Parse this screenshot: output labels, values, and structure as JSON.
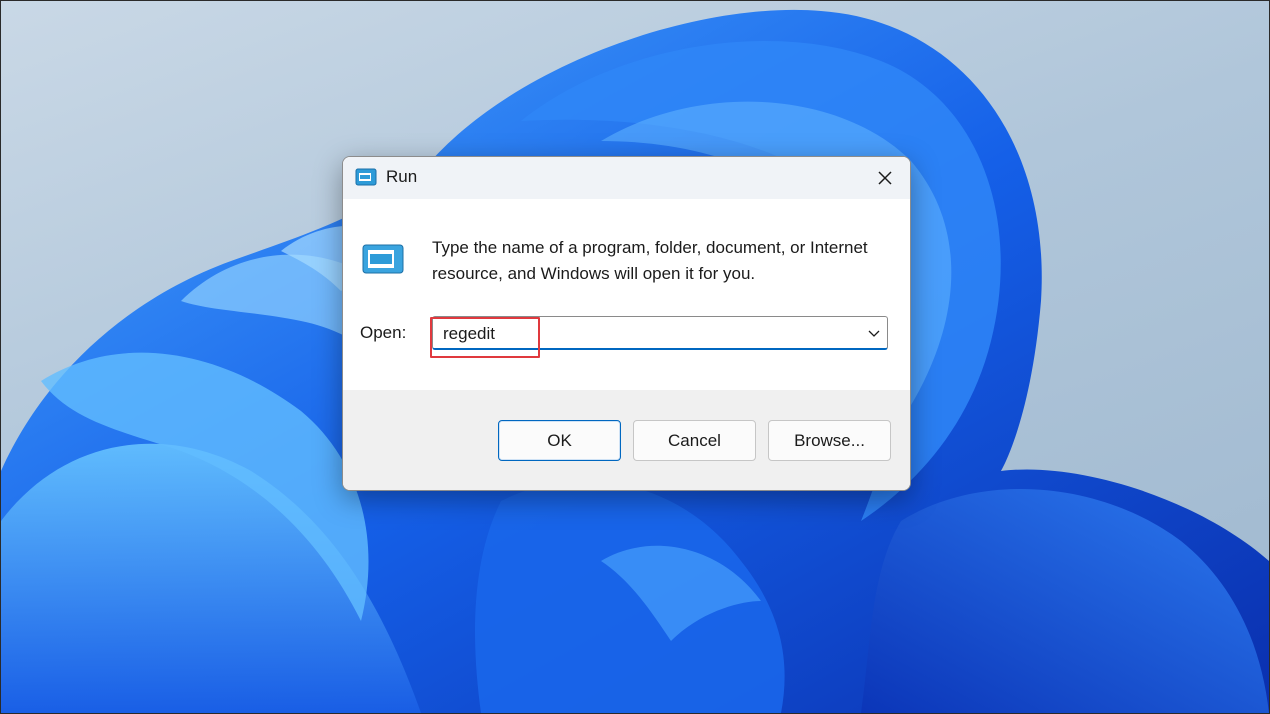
{
  "wallpaper": {
    "name": "Windows 11 bloom wallpaper",
    "accent": "#0f5fe0"
  },
  "dialog": {
    "title": "Run",
    "close_icon": "close-icon",
    "app_icon": "run-icon",
    "description": "Type the name of a program, folder, document, or Internet resource, and Windows will open it for you.",
    "open_label": "Open:",
    "open_value": "regedit",
    "dropdown_icon": "chevron-down-icon",
    "buttons": {
      "ok": "OK",
      "cancel": "Cancel",
      "browse": "Browse..."
    }
  },
  "annotation": {
    "highlight_color": "#e0393e"
  }
}
